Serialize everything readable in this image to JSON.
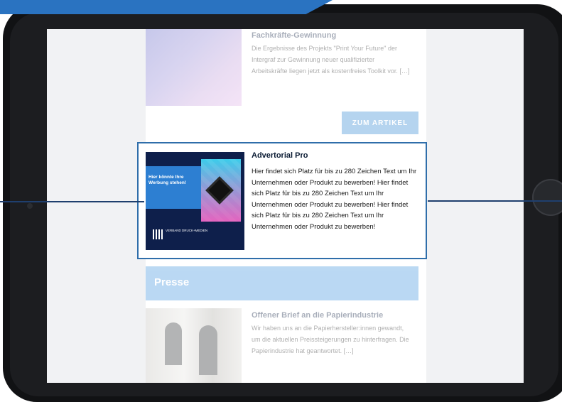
{
  "article1": {
    "title": "Fachkräfte-Gewinnung",
    "text": "Die Ergebnisse des Projekts \"Print Your Future\" der Intergraf zur Gewinnung neuer qualifizierter Arbeitskräfte liegen jetzt als kostenfreies Toolkit vor. […]",
    "button_label": "ZUM ARTIKEL"
  },
  "advertorial": {
    "title": "Advertorial Pro",
    "text": "Hier findet sich Platz für bis zu 280 Zeichen Text um Ihr Unternehmen oder Produkt zu bewerben! Hier findet sich Platz für bis zu 280 Zeichen Text um Ihr Unternehmen oder Produkt zu bewerben! Hier findet sich Platz für bis zu 280 Zeichen Text um Ihr Unternehmen oder Produkt zu bewerben!",
    "image_text": "Hier könnte Ihre Werbung stehen!",
    "logo_text": "VERBAND DRUCK+MEDIEN"
  },
  "press": {
    "heading": "Presse"
  },
  "article2": {
    "title": "Offener Brief an die Papierindustrie",
    "text": "Wir haben uns an die Papierhersteller:innen gewandt, um die aktuellen Preissteigerungen zu hinterfragen. Die Papierindustrie hat geantwortet. […]"
  },
  "colors": {
    "accent": "#3f8fd6",
    "highlight_border": "#2f6eaa",
    "device": "#111214"
  }
}
